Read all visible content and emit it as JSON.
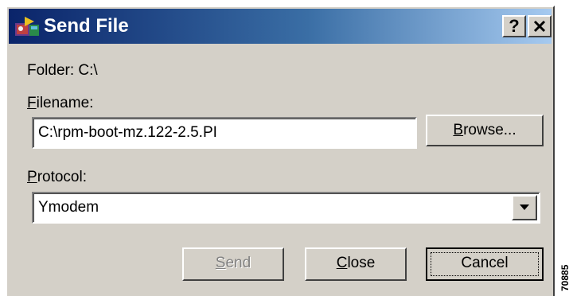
{
  "window": {
    "title": "Send File",
    "help_label": "?",
    "close_label": "✕"
  },
  "folder": {
    "label": "Folder:",
    "value": "C:\\"
  },
  "filename": {
    "label_accel": "F",
    "label_rest": "ilename:",
    "value": "C:\\rpm-boot-mz.122-2.5.PI",
    "browse_accel": "B",
    "browse_rest": "rowse..."
  },
  "protocol": {
    "label_accel": "P",
    "label_rest": "rotocol:",
    "selected": "Ymodem"
  },
  "buttons": {
    "send_accel": "S",
    "send_rest": "end",
    "close_accel": "C",
    "close_rest": "lose",
    "cancel": "Cancel"
  },
  "figure_number": "70885",
  "icons": {
    "app": "send-file-app-icon",
    "dropdown": "chevron-down-icon"
  },
  "colors": {
    "titlebar_start": "#0a246a",
    "titlebar_end": "#a6caf0",
    "dialog_bg": "#d4d0c8"
  }
}
